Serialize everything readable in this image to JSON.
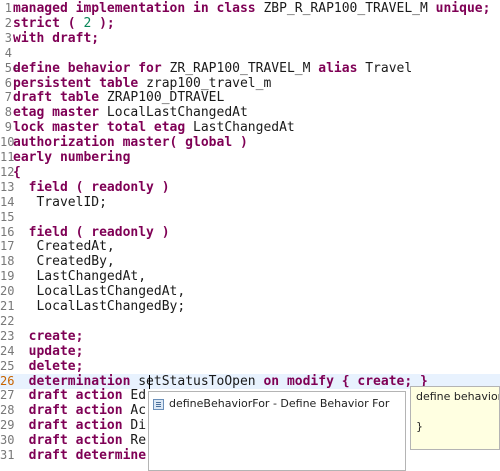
{
  "editor": {
    "current_line": 26,
    "lines": [
      {
        "n": "1",
        "parts": [
          {
            "t": "managed implementation in class ",
            "c": "kw"
          },
          {
            "t": "ZBP_R_RAP100_TRAVEL_M ",
            "c": "tx"
          },
          {
            "t": "unique;",
            "c": "kw"
          }
        ]
      },
      {
        "n": "2",
        "parts": [
          {
            "t": "strict ( ",
            "c": "kw"
          },
          {
            "t": "2",
            "c": "num"
          },
          {
            "t": " );",
            "c": "kw"
          }
        ]
      },
      {
        "n": "3",
        "parts": [
          {
            "t": "with draft;",
            "c": "kw"
          }
        ]
      },
      {
        "n": "4",
        "parts": []
      },
      {
        "n": "5",
        "fold": true,
        "parts": [
          {
            "t": "define behavior for ",
            "c": "kw"
          },
          {
            "t": "ZR_RAP100_TRAVEL_M ",
            "c": "tx"
          },
          {
            "t": "alias ",
            "c": "kw"
          },
          {
            "t": "Travel",
            "c": "tx"
          }
        ]
      },
      {
        "n": "6",
        "parts": [
          {
            "t": "persistent table ",
            "c": "kw"
          },
          {
            "t": "zrap100_travel_m",
            "c": "tx"
          }
        ]
      },
      {
        "n": "7",
        "parts": [
          {
            "t": "draft table ",
            "c": "kw"
          },
          {
            "t": "ZRAP100_DTRAVEL",
            "c": "tx"
          }
        ]
      },
      {
        "n": "8",
        "parts": [
          {
            "t": "etag master ",
            "c": "kw"
          },
          {
            "t": "LocalLastChangedAt",
            "c": "tx"
          }
        ]
      },
      {
        "n": "9",
        "parts": [
          {
            "t": "lock master total etag ",
            "c": "kw"
          },
          {
            "t": "LastChangedAt",
            "c": "tx"
          }
        ]
      },
      {
        "n": "10",
        "parts": [
          {
            "t": "authorization master( global )",
            "c": "kw"
          }
        ]
      },
      {
        "n": "11",
        "parts": [
          {
            "t": "early numbering",
            "c": "kw"
          }
        ]
      },
      {
        "n": "12",
        "parts": [
          {
            "t": "{",
            "c": "kw"
          }
        ]
      },
      {
        "n": "13",
        "parts": [
          {
            "t": "  field ( readonly )",
            "c": "kw"
          }
        ]
      },
      {
        "n": "14",
        "parts": [
          {
            "t": "   TravelID;",
            "c": "tx"
          }
        ]
      },
      {
        "n": "15",
        "parts": []
      },
      {
        "n": "16",
        "parts": [
          {
            "t": "  field ( readonly )",
            "c": "kw"
          }
        ]
      },
      {
        "n": "17",
        "parts": [
          {
            "t": "   CreatedAt,",
            "c": "tx"
          }
        ]
      },
      {
        "n": "18",
        "parts": [
          {
            "t": "   CreatedBy,",
            "c": "tx"
          }
        ]
      },
      {
        "n": "19",
        "parts": [
          {
            "t": "   LastChangedAt,",
            "c": "tx"
          }
        ]
      },
      {
        "n": "20",
        "parts": [
          {
            "t": "   LocalLastChangedAt,",
            "c": "tx"
          }
        ]
      },
      {
        "n": "21",
        "parts": [
          {
            "t": "   LocalLastChangedBy;",
            "c": "tx"
          }
        ]
      },
      {
        "n": "22",
        "parts": []
      },
      {
        "n": "23",
        "parts": [
          {
            "t": "  create;",
            "c": "kw"
          }
        ]
      },
      {
        "n": "24",
        "parts": [
          {
            "t": "  update;",
            "c": "kw"
          }
        ]
      },
      {
        "n": "25",
        "parts": [
          {
            "t": "  delete;",
            "c": "kw"
          }
        ]
      },
      {
        "n": "26",
        "parts": [
          {
            "t": "  determination ",
            "c": "kw"
          },
          {
            "t": "setStatusToOpen ",
            "c": "tx"
          },
          {
            "t": "on modify { create; }",
            "c": "kw"
          }
        ]
      },
      {
        "n": "27",
        "parts": [
          {
            "t": "  draft action ",
            "c": "kw"
          },
          {
            "t": "Ed",
            "c": "tx"
          }
        ]
      },
      {
        "n": "28",
        "parts": [
          {
            "t": "  draft action ",
            "c": "kw"
          },
          {
            "t": "Ac",
            "c": "tx"
          }
        ]
      },
      {
        "n": "29",
        "parts": [
          {
            "t": "  draft action ",
            "c": "kw"
          },
          {
            "t": "Di",
            "c": "tx"
          }
        ]
      },
      {
        "n": "30",
        "parts": [
          {
            "t": "  draft action ",
            "c": "kw"
          },
          {
            "t": "Re",
            "c": "tx"
          }
        ]
      },
      {
        "n": "31",
        "parts": [
          {
            "t": "  draft determine",
            "c": "kw"
          }
        ]
      }
    ]
  },
  "content_assist": {
    "icon": "template-icon",
    "item_label": "defineBehaviorFor - Define Behavior For"
  },
  "info_popup": {
    "text": "define behavior",
    "brace": "}"
  },
  "colors": {
    "keyword": "#7f0055",
    "text": "#1a1a1a",
    "number": "#098658",
    "current_line_bg": "#e8f2fe",
    "info_bg": "#ffffe1"
  }
}
